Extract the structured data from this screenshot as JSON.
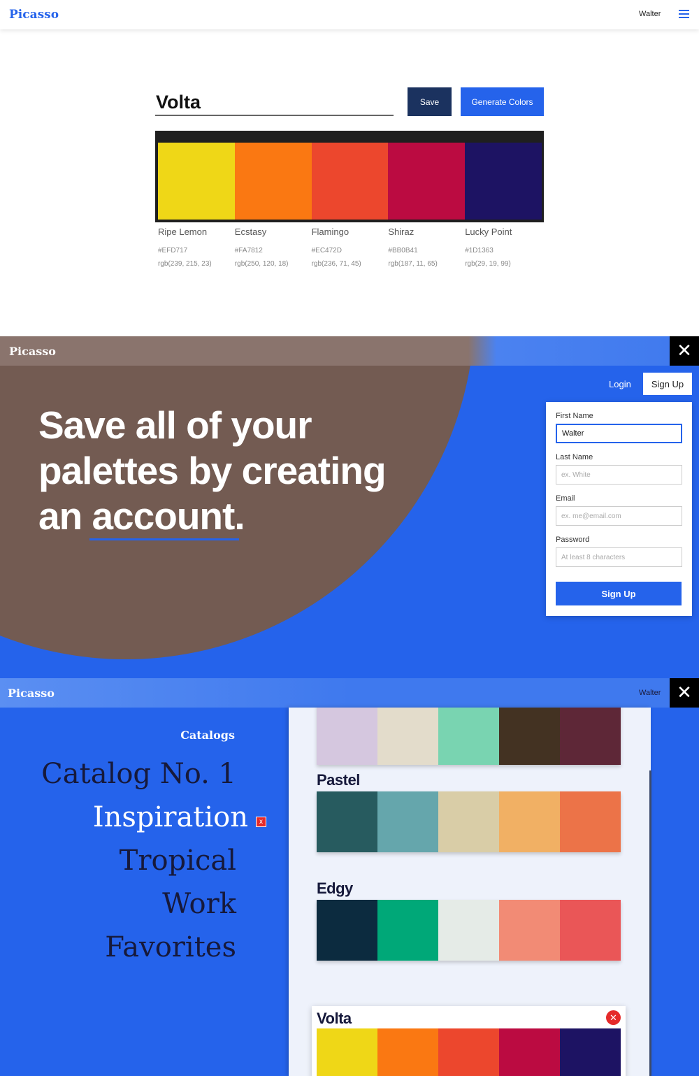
{
  "editor": {
    "logo": "Picasso",
    "user": "Walter",
    "palette_name": "Volta",
    "save_label": "Save",
    "generate_label": "Generate Colors",
    "colors": [
      {
        "name": "Ripe Lemon",
        "hex": "#EFD717",
        "rgb": "rgb(239, 215, 23)"
      },
      {
        "name": "Ecstasy",
        "hex": "#FA7812",
        "rgb": "rgb(250, 120, 18)"
      },
      {
        "name": "Flamingo",
        "hex": "#EC472D",
        "rgb": "rgb(236, 71, 45)"
      },
      {
        "name": "Shiraz",
        "hex": "#BB0B41",
        "rgb": "rgb(187, 11, 65)"
      },
      {
        "name": "Lucky Point",
        "hex": "#1D1363",
        "rgb": "rgb(29, 19, 99)"
      }
    ]
  },
  "signup": {
    "logo": "Picasso",
    "close_icon": "close-icon",
    "login_label": "Login",
    "signup_top_label": "Sign Up",
    "headline_line1": "Save all of your",
    "headline_line2": "palettes by creating",
    "headline_line3_a": "an ",
    "headline_line3_b": "account.",
    "form": {
      "first_name_label": "First Name",
      "first_name_value": "Walter",
      "last_name_label": "Last Name",
      "last_name_placeholder": "ex. White",
      "email_label": "Email",
      "email_placeholder": "ex. me@email.com",
      "password_label": "Password",
      "password_placeholder": "At least 8 characters",
      "submit_label": "Sign Up"
    },
    "colors": {
      "brand": "#2563EB",
      "brown": "#735B52"
    }
  },
  "catalogs": {
    "logo": "Picasso",
    "user": "Walter",
    "close_icon": "close-icon",
    "heading": "Catalogs",
    "items": [
      "Catalog No. 1",
      "Inspiration",
      "Tropical",
      "Work",
      "Favorites"
    ],
    "active_item": "Inspiration",
    "delete_label": "x",
    "palettes": [
      {
        "title": "",
        "colors": [
          "#D5C7DF",
          "#E3DCCB",
          "#79D4B1",
          "#433222",
          "#5E2737"
        ]
      },
      {
        "title": "Pastel",
        "colors": [
          "#275B5F",
          "#65A6AC",
          "#D9CDA7",
          "#F1B064",
          "#EC7348"
        ]
      },
      {
        "title": "Edgy",
        "colors": [
          "#0C2B3F",
          "#00A878",
          "#E5EBE7",
          "#F28B75",
          "#EA5657"
        ]
      },
      {
        "title": "Volta",
        "colors": [
          "#EFD717",
          "#FA7812",
          "#EC472D",
          "#BB0B41",
          "#1D1363"
        ]
      }
    ]
  }
}
